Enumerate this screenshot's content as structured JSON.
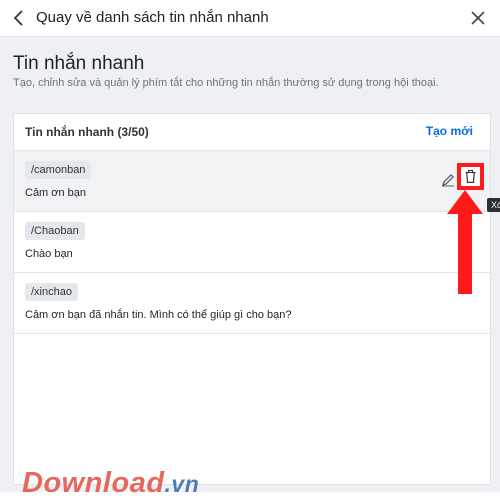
{
  "header": {
    "title": "Quay về danh sách tin nhắn nhanh",
    "back_icon": "chevron-left-icon",
    "close_icon": "close-icon"
  },
  "page": {
    "title": "Tin nhắn nhanh",
    "description": "Tạo, chỉnh sửa và quản lý phím tắt cho những tin nhắn thường sử dụng trong hội thoại."
  },
  "panel": {
    "heading": "Tin nhắn nhanh (3/50)",
    "create_label": "Tạo mới"
  },
  "items": [
    {
      "shortcut": "/camonban",
      "message": "Cảm ơn bạn"
    },
    {
      "shortcut": "/Chaoban",
      "message": "Chào bạn"
    },
    {
      "shortcut": "/xinchao",
      "message": "Cảm ơn bạn đã nhắn tin. Mình có thể giúp gì cho bạn?"
    }
  ],
  "tooltip": "Xóa",
  "watermark": {
    "main": "Download",
    "suffix": ".vn"
  },
  "colors": {
    "accent": "#0a68e2",
    "highlight": "#ff1b1b",
    "page_bg": "#eef0f3"
  }
}
